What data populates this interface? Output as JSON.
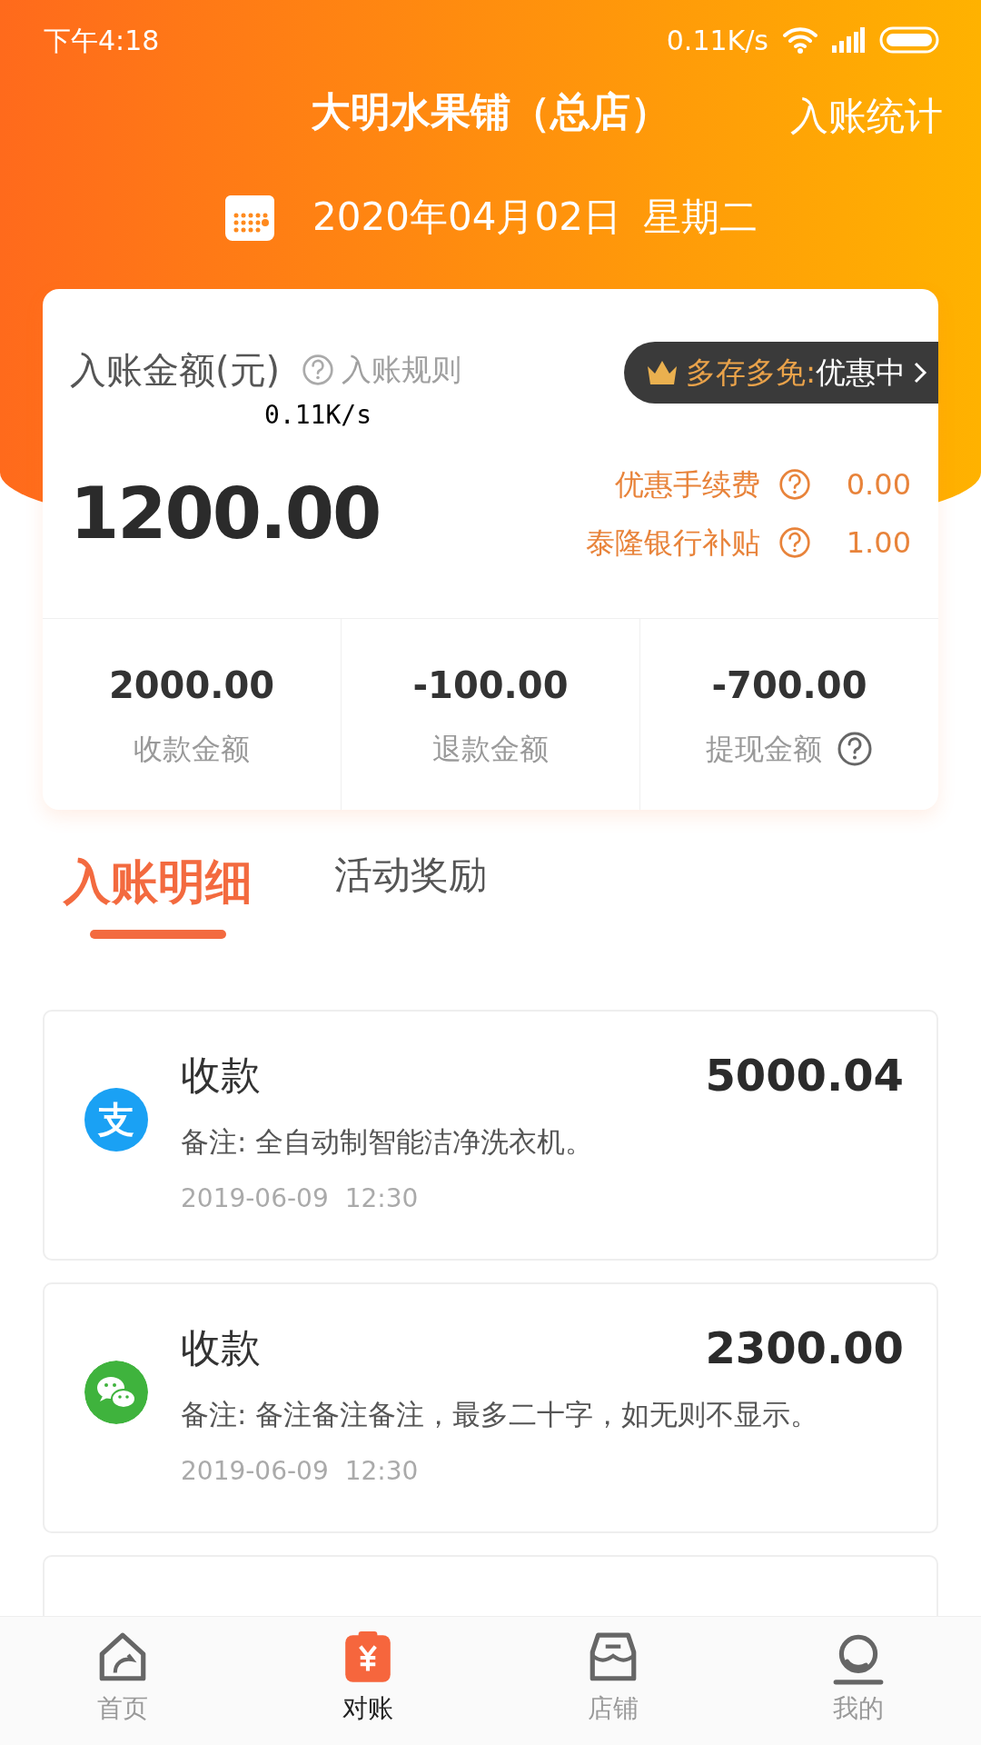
{
  "status_bar": {
    "time": "下午4:18",
    "network_speed": "0.11K/s"
  },
  "header": {
    "title": "大明水果铺（总店）",
    "action": "入账统计"
  },
  "date_bar": {
    "date": "2020年04月02日",
    "weekday": "星期二"
  },
  "summary": {
    "label": "入账金额(元)",
    "rule_link": "入账规则",
    "promo": {
      "highlight": "多存多免:",
      "text": "优惠中"
    },
    "floating_speed": "0.11K/s",
    "amount": "1200.00",
    "adjustments": [
      {
        "label": "优惠手续费",
        "value": "0.00"
      },
      {
        "label": "泰隆银行补贴",
        "value": "1.00"
      }
    ],
    "totals": [
      {
        "value": "2000.00",
        "label": "收款金额",
        "help": false
      },
      {
        "value": "-100.00",
        "label": "退款金额",
        "help": false
      },
      {
        "value": "-700.00",
        "label": "提现金额",
        "help": true
      }
    ]
  },
  "tabs": [
    {
      "label": "入账明细",
      "selected": true
    },
    {
      "label": "活动奖励",
      "selected": false
    }
  ],
  "transactions": [
    {
      "kind": "alipay",
      "logo": "支",
      "title": "收款",
      "amount": "5000.04",
      "note": "备注: 全自动制智能洁净洗衣机。",
      "date": "2019-06-09",
      "time": "12:30"
    },
    {
      "kind": "wechat",
      "title": "收款",
      "amount": "2300.00",
      "note": "备注: 备注备注备注，最多二十字，如无则不显示。",
      "date": "2019-06-09",
      "time": "12:30"
    },
    {
      "kind": "hidden"
    }
  ],
  "bottom_nav": [
    {
      "kind": "home",
      "label": "首页",
      "selected": false
    },
    {
      "kind": "ledger",
      "label": "对账",
      "selected": true
    },
    {
      "kind": "shop",
      "label": "店铺",
      "selected": false
    },
    {
      "kind": "profile",
      "label": "我的",
      "selected": false
    }
  ]
}
